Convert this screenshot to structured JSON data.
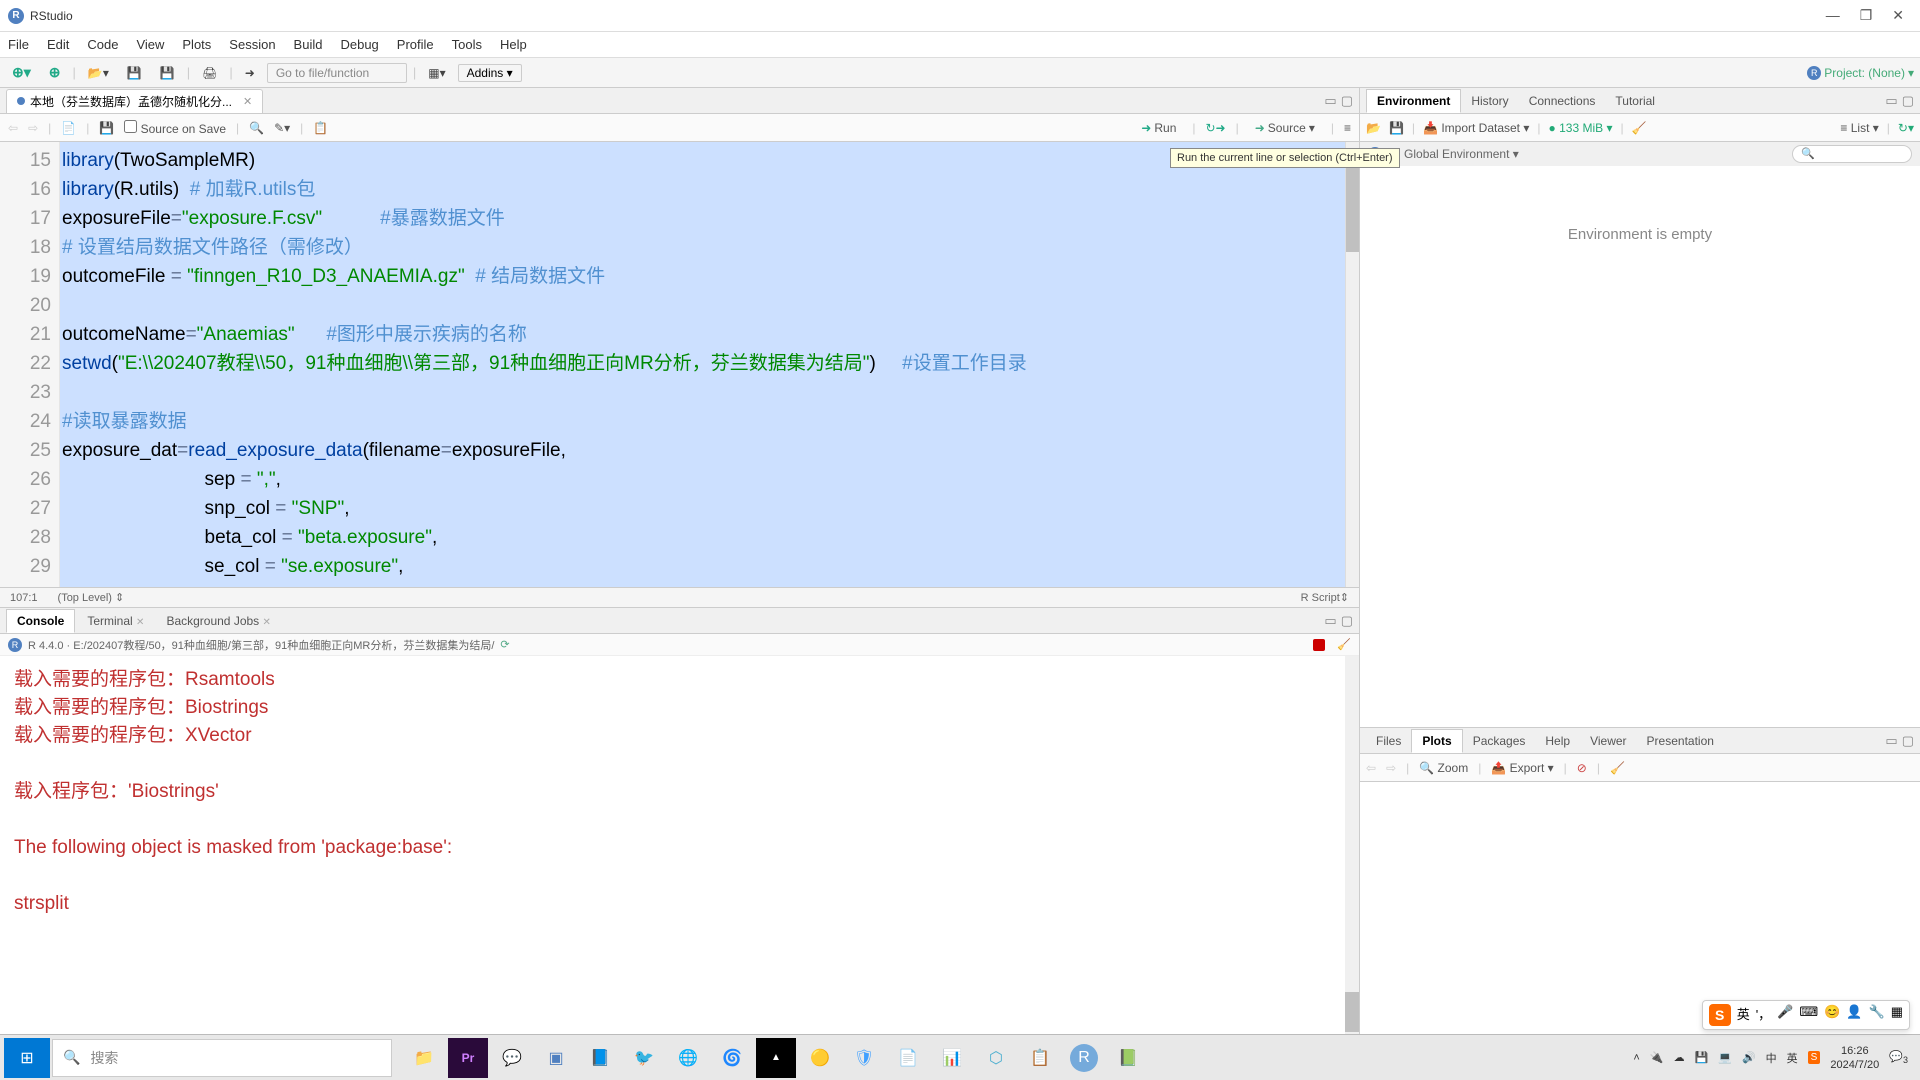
{
  "window": {
    "title": "RStudio"
  },
  "menu": [
    "File",
    "Edit",
    "Code",
    "View",
    "Plots",
    "Session",
    "Build",
    "Debug",
    "Profile",
    "Tools",
    "Help"
  ],
  "toolbar": {
    "goto_placeholder": "Go to file/function",
    "addins": "Addins",
    "project": "Project: (None)"
  },
  "file_tab": {
    "name": "本地（芬兰数据库）孟德尔随机化分..."
  },
  "src_toolbar": {
    "source_on_save": "Source on Save",
    "run": "Run",
    "source": "Source"
  },
  "tooltip_run": "Run the current line or selection (Ctrl+Enter)",
  "gutter": [
    "15",
    "16",
    "17",
    "18",
    "19",
    "20",
    "21",
    "22",
    " ",
    "23",
    "24",
    "25",
    "26",
    "27",
    "28",
    "29"
  ],
  "code": {
    "l15a": "library",
    "l15b": "(TwoSampleMR)",
    "l16a": "library",
    "l16b": "(R.utils)  ",
    "l16c": "# 加载R.utils包",
    "l17a": "exposureFile",
    "l17b": "=",
    "l17c": "\"exposure.F.csv\"",
    "l17d": "           #暴露数据文件",
    "l18": "# 设置结局数据文件路径（需修改）",
    "l19a": "outcomeFile ",
    "l19b": "= ",
    "l19c": "\"finngen_R10_D3_ANAEMIA.gz\"",
    "l19d": "  # 结局数据文件",
    "l21a": "outcomeName",
    "l21b": "=",
    "l21c": "\"Anaemias\"",
    "l21d": "      #图形中展示疾病的名称",
    "l22a": "setwd",
    "l22b": "(",
    "l22c": "\"E:\\\\202407教程\\\\50，91种血细胞\\\\第三部，91种血细胞正向MR分析，芬兰数据集为结局\"",
    "l22d": ")     ",
    "l22e": "#设置工作目录",
    "l24": "#读取暴露数据",
    "l25a": "exposure_dat",
    "l25b": "=",
    "l25c": "read_exposure_data",
    "l25d": "(filename",
    "l25e": "=",
    "l25f": "exposureFile,",
    "l26a": "                           sep ",
    "l26b": "= ",
    "l26c": "\",\"",
    "l26d": ",",
    "l27a": "                           snp_col ",
    "l27b": "= ",
    "l27c": "\"SNP\"",
    "l27d": ",",
    "l28a": "                           beta_col ",
    "l28b": "= ",
    "l28c": "\"beta.exposure\"",
    "l28d": ",",
    "l29a": "                           se_col ",
    "l29b": "= ",
    "l29c": "\"se.exposure\"",
    "l29d": ","
  },
  "status": {
    "pos": "107:1",
    "scope": "(Top Level)",
    "lang": "R Script"
  },
  "console_tabs": [
    "Console",
    "Terminal",
    "Background Jobs"
  ],
  "console_path": "R 4.4.0 · E:/202407教程/50，91种血细胞/第三部，91种血细胞正向MR分析，芬兰数据集为结局/",
  "console": {
    "l1": "载入需要的程序包：Rsamtools",
    "l2": "载入需要的程序包：Biostrings",
    "l3": "载入需要的程序包：XVector",
    "l5a": "载入程序包：",
    "l5b": "'Biostrings'",
    "l7a": "The following object is masked from ",
    "l7b": "'package:base'",
    "l7c": ":",
    "l9": "    strsplit"
  },
  "env_tabs": [
    "Environment",
    "History",
    "Connections",
    "Tutorial"
  ],
  "env_toolbar": {
    "import": "Import Dataset",
    "mem": "133 MiB",
    "list": "List"
  },
  "env_sub": {
    "scope": "Global Environment"
  },
  "env_empty": "Environment is empty",
  "plots_tabs": [
    "Files",
    "Plots",
    "Packages",
    "Help",
    "Viewer",
    "Presentation"
  ],
  "plots_toolbar": {
    "zoom": "Zoom",
    "export": "Export"
  },
  "taskbar": {
    "search": "搜索",
    "time": "16:26",
    "date": "2024/7/20"
  },
  "ime": {
    "lang": "英"
  }
}
